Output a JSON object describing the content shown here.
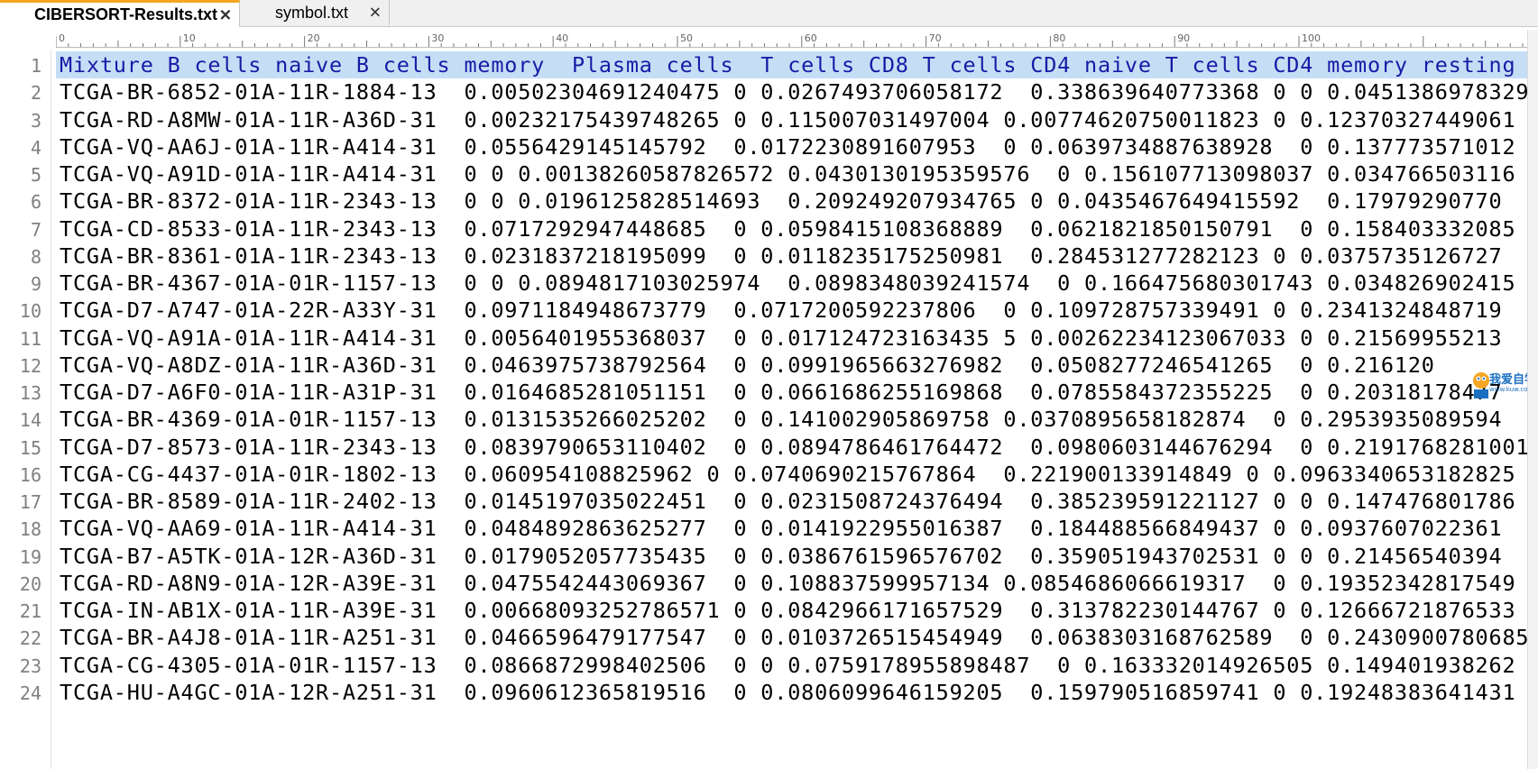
{
  "tabs": [
    {
      "label": "CIBERSORT-Results.txt",
      "active": true
    },
    {
      "label": "symbol.txt",
      "active": false
    }
  ],
  "ruler": {
    "labels": [
      "0",
      "10",
      "20",
      "30",
      "40",
      "50",
      "60",
      "70",
      "80",
      "90",
      "100"
    ]
  },
  "editor": {
    "lines": [
      {
        "n": "1",
        "text": "Mixture B cells naive B cells memory  Plasma cells  T cells CD8 T cells CD4 naive T cells CD4 memory resting"
      },
      {
        "n": "2",
        "text": "TCGA-BR-6852-01A-11R-1884-13  0.00502304691240475 0 0.0267493706058172  0.338639640773368 0 0 0.0451386978329"
      },
      {
        "n": "3",
        "text": "TCGA-RD-A8MW-01A-11R-A36D-31  0.00232175439748265 0 0.115007031497004 0.00774620750011823 0 0.12370327449061"
      },
      {
        "n": "4",
        "text": "TCGA-VQ-AA6J-01A-11R-A414-31  0.0556429145145792  0.0172230891607953  0 0.0639734887638928  0 0.137773571012"
      },
      {
        "n": "5",
        "text": "TCGA-VQ-A91D-01A-11R-A414-31  0 0 0.00138260587826572 0.0430130195359576  0 0.156107713098037 0.034766503116"
      },
      {
        "n": "6",
        "text": "TCGA-BR-8372-01A-11R-2343-13  0 0 0.0196125828514693  0.209249207934765 0 0.0435467649415592  0.17979290770"
      },
      {
        "n": "7",
        "text": "TCGA-CD-8533-01A-11R-2343-13  0.0717292947448685  0 0.0598415108368889  0.0621821850150791  0 0.158403332085"
      },
      {
        "n": "8",
        "text": "TCGA-BR-8361-01A-11R-2343-13  0.0231837218195099  0 0.0118235175250981  0.284531277282123 0 0.0375735126727"
      },
      {
        "n": "9",
        "text": "TCGA-BR-4367-01A-01R-1157-13  0 0 0.0894817103025974  0.0898348039241574  0 0.166475680301743 0.034826902415"
      },
      {
        "n": "10",
        "text": "TCGA-D7-A747-01A-22R-A33Y-31  0.0971184948673779  0.0717200592237806  0 0.109728757339491 0 0.2341324848719"
      },
      {
        "n": "11",
        "text": "TCGA-VQ-A91A-01A-11R-A414-31  0.0056401955368037  0 0.017124723163435 5 0.00262234123067033 0 0.21569955213"
      },
      {
        "n": "12",
        "text": "TCGA-VQ-A8DZ-01A-11R-A36D-31  0.0463975738792564  0 0.0991965663276982  0.0508277246541265  0 0.216120"
      },
      {
        "n": "13",
        "text": "TCGA-D7-A6F0-01A-11R-A31P-31  0.0164685281051151  0 0.0661686255169868  0.0785584372355225  0 0.20318178477"
      },
      {
        "n": "14",
        "text": "TCGA-BR-4369-01A-01R-1157-13  0.0131535266025202  0 0.141002905869758 0.0370895658182874  0 0.2953935089594"
      },
      {
        "n": "15",
        "text": "TCGA-D7-8573-01A-11R-2343-13  0.0839790653110402  0 0.0894786461764472  0.0980603144676294  0 0.2191768281001"
      },
      {
        "n": "16",
        "text": "TCGA-CG-4437-01A-01R-1802-13  0.060954108825962 0 0.0740690215767864  0.221900133914849 0 0.0963340653182825"
      },
      {
        "n": "17",
        "text": "TCGA-BR-8589-01A-11R-2402-13  0.0145197035022451  0 0.0231508724376494  0.385239591221127 0 0 0.147476801786"
      },
      {
        "n": "18",
        "text": "TCGA-VQ-AA69-01A-11R-A414-31  0.0484892863625277  0 0.0141922955016387  0.184488566849437 0 0.0937607022361"
      },
      {
        "n": "19",
        "text": "TCGA-B7-A5TK-01A-12R-A36D-31  0.0179052057735435  0 0.0386761596576702  0.359051943702531 0 0 0.21456540394"
      },
      {
        "n": "20",
        "text": "TCGA-RD-A8N9-01A-12R-A39E-31  0.0475542443069367  0 0.108837599957134 0.0854686066619317  0 0.19352342817549"
      },
      {
        "n": "21",
        "text": "TCGA-IN-AB1X-01A-11R-A39E-31  0.00668093252786571 0 0.0842966171657529  0.313782230144767 0 0.12666721876533"
      },
      {
        "n": "22",
        "text": "TCGA-BR-A4J8-01A-11R-A251-31  0.0466596479177547  0 0.0103726515454949  0.0638303168762589  0 0.2430900780685"
      },
      {
        "n": "23",
        "text": "TCGA-CG-4305-01A-01R-1157-13  0.0866872998402506  0 0 0.0759178955898487  0 0.163332014926505 0.149401938262"
      },
      {
        "n": "24",
        "text": "TCGA-HU-A4GC-01A-12R-A251-31  0.0960612365819516  0 0.0806099646159205  0.159790516859741 0 0.19248383641431"
      }
    ]
  },
  "watermark": {
    "text": "我爱自学网",
    "url": "www.kuw.com"
  },
  "colors": {
    "active_tab_accent": "#f5a623",
    "header_selection": "#c5def5",
    "header_text": "#1a1aa6",
    "line_number": "#808080"
  }
}
